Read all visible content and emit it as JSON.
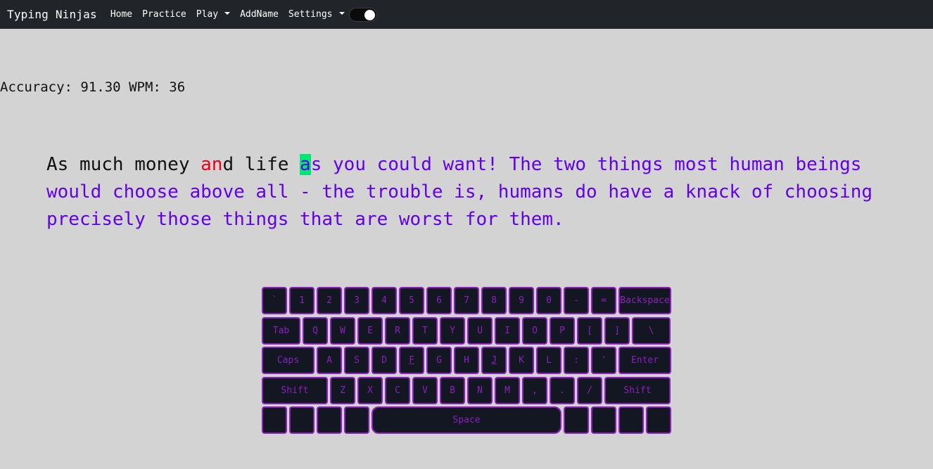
{
  "nav": {
    "brand": "Typing Ninjas",
    "home": "Home",
    "practice": "Practice",
    "play": "Play",
    "addname": "AddName",
    "settings": "Settings"
  },
  "stats": {
    "accuracy_label": "Accuracy:",
    "accuracy_value": "91.30",
    "wpm_label": "WPM:",
    "wpm_value": "36"
  },
  "passage": {
    "typed_1": "As much money ",
    "wrong": "an",
    "typed_2": "d life ",
    "cursor": "a",
    "rest": "s you could want! The two things most human beings would choose above all - the trouble is, humans do have a knack of choosing precisely those things that are worst for them."
  },
  "keyboard": {
    "row1": [
      "`",
      "1",
      "2",
      "3",
      "4",
      "5",
      "6",
      "7",
      "8",
      "9",
      "0",
      "-",
      "=",
      "Backspace"
    ],
    "row2": [
      "Tab",
      "Q",
      "W",
      "E",
      "R",
      "T",
      "Y",
      "U",
      "I",
      "O",
      "P",
      "[",
      "]",
      "\\"
    ],
    "row3": [
      "Caps",
      "A",
      "S",
      "D",
      "F",
      "G",
      "H",
      "J",
      "K",
      "L",
      ":",
      "'",
      "Enter"
    ],
    "row4": [
      "Shift",
      "Z",
      "X",
      "C",
      "V",
      "B",
      "N",
      "M",
      ",",
      ".",
      "/",
      "Shift"
    ],
    "row5": [
      "",
      "",
      "",
      "",
      "Space",
      "",
      "",
      "",
      ""
    ]
  },
  "colors": {
    "navbar": "#212529",
    "background": "#d3d3d3",
    "upcoming_text": "#6200ea",
    "error_text": "#e8001c",
    "cursor_highlight": "#00e676",
    "key_border": "#8c1fbe",
    "key_fill": "#131722"
  }
}
